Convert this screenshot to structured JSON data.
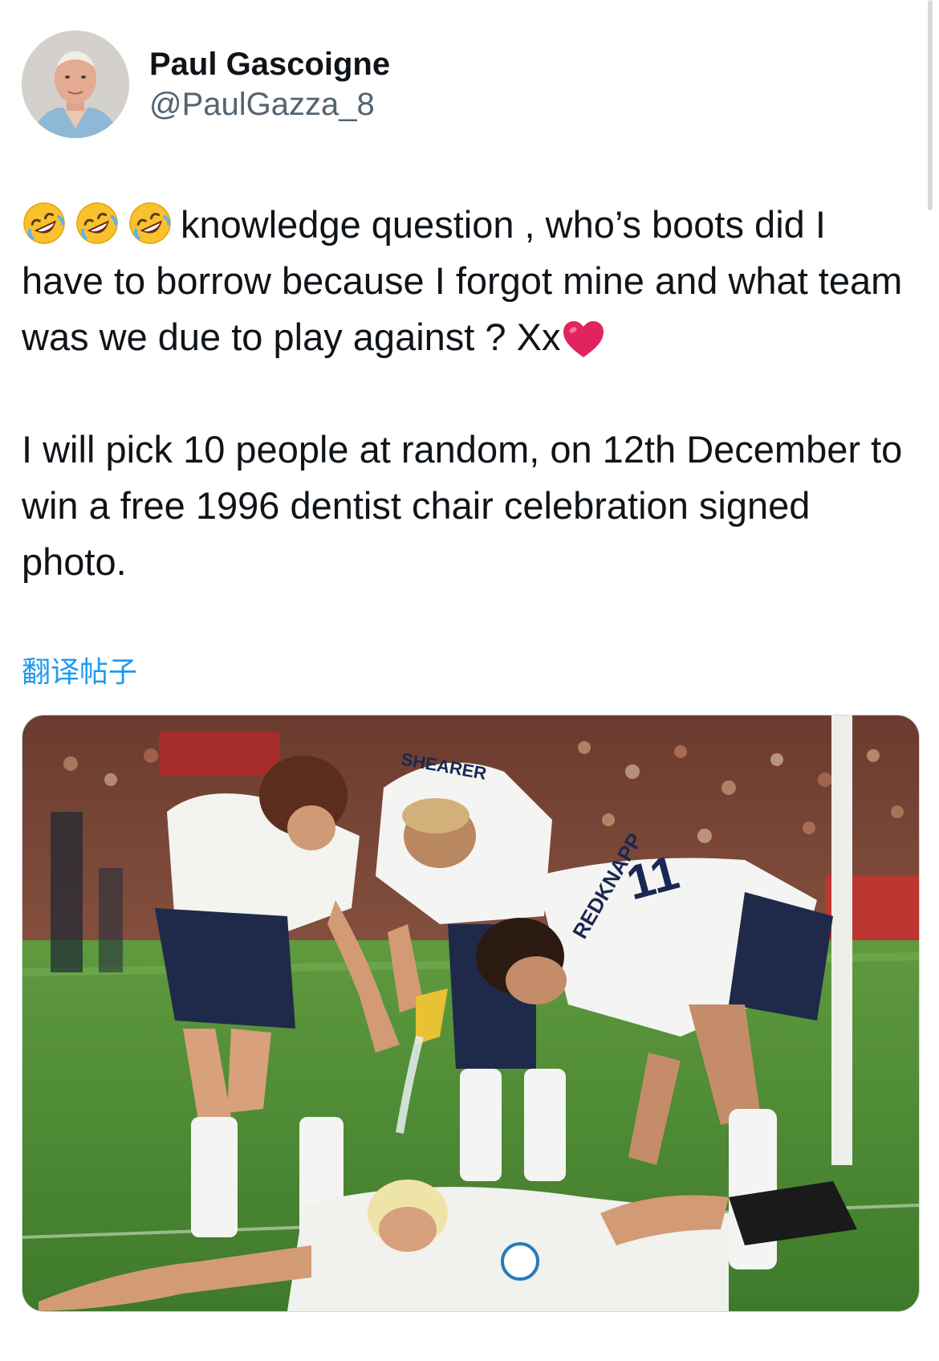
{
  "author": {
    "display_name": "Paul Gascoigne",
    "handle": "@PaulGazza_8",
    "avatar_icon": "profile-photo"
  },
  "tweet": {
    "line1_emojis": [
      "rolling-on-floor-laughing",
      "rolling-on-floor-laughing",
      "rolling-on-floor-laughing"
    ],
    "paragraph1_text": "knowledge question , who’s boots did I have to borrow because I forgot mine and what team was we due to play against ? Xx",
    "paragraph1_end_emoji": "red-heart",
    "paragraph2_text": "I will pick 10 people at random, on 12th December to win a free 1996 dentist chair celebration signed photo."
  },
  "translate_link": "翻译帖子",
  "media": {
    "kind": "photo",
    "shirt_name_1": "SHEARER",
    "shirt_name_2": "REDKNAPP",
    "shirt_number": "11"
  },
  "colors": {
    "link_blue": "#1d9bf0",
    "secondary_text": "#536471",
    "primary_text": "#0f1419",
    "heart_red": "#e0245e"
  }
}
